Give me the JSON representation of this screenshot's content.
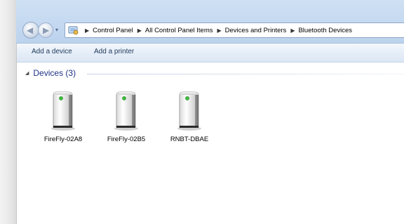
{
  "navigation": {
    "breadcrumbs": [
      "Control Panel",
      "All Control Panel Items",
      "Devices and Printers",
      "Bluetooth Devices"
    ]
  },
  "toolbar": {
    "add_device_label": "Add a device",
    "add_printer_label": "Add a printer"
  },
  "content": {
    "group_title": "Devices (3)",
    "devices": [
      {
        "name": "FireFly-02A8",
        "icon": "generic-device-icon"
      },
      {
        "name": "FireFly-02B5",
        "icon": "generic-device-icon"
      },
      {
        "name": "RNBT-DBAE",
        "icon": "generic-device-icon"
      }
    ]
  },
  "colors": {
    "titlebar": "#c6daf1",
    "toolbar": "#e6eef8",
    "group_header_text": "#1e3287",
    "device_led": "#3fbf3f"
  }
}
